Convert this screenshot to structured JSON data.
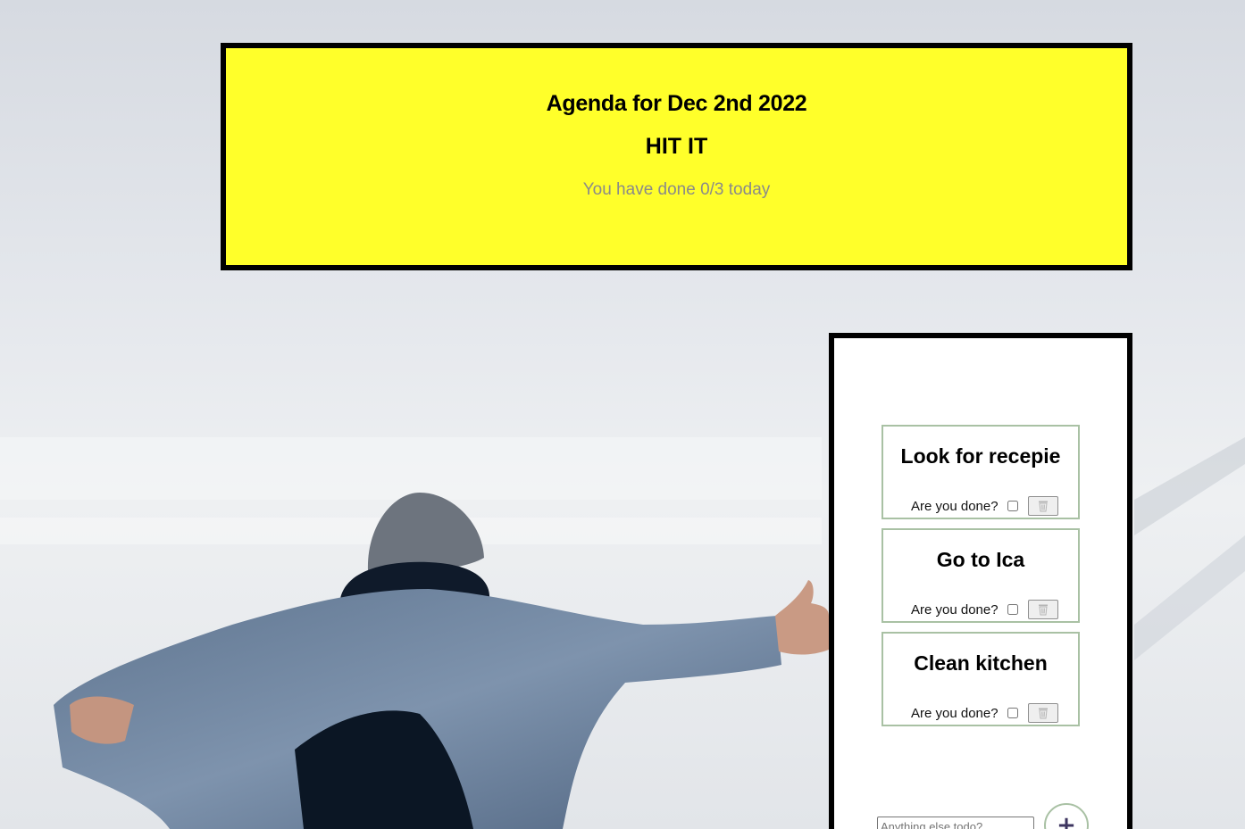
{
  "header": {
    "title": "Agenda for Dec 2nd 2022",
    "subtitle": "HIT IT",
    "progress": "You have done 0/3 today"
  },
  "todos": [
    {
      "title": "Look for recepie",
      "done_label": "Are you done?",
      "done": false,
      "delete_icon": "trash-icon"
    },
    {
      "title": "Go to Ica",
      "done_label": "Are you done?",
      "done": false,
      "delete_icon": "trash-icon"
    },
    {
      "title": "Clean kitchen",
      "done_label": "Are you done?",
      "done": false,
      "delete_icon": "trash-icon"
    }
  ],
  "add": {
    "placeholder": "Anything else todo?",
    "button_label": "+"
  },
  "colors": {
    "header_bg": "#ffff2a",
    "border": "#000000",
    "item_border": "#a9c1a4",
    "progress_text": "#8a8a8a",
    "add_icon": "#3d3560"
  }
}
